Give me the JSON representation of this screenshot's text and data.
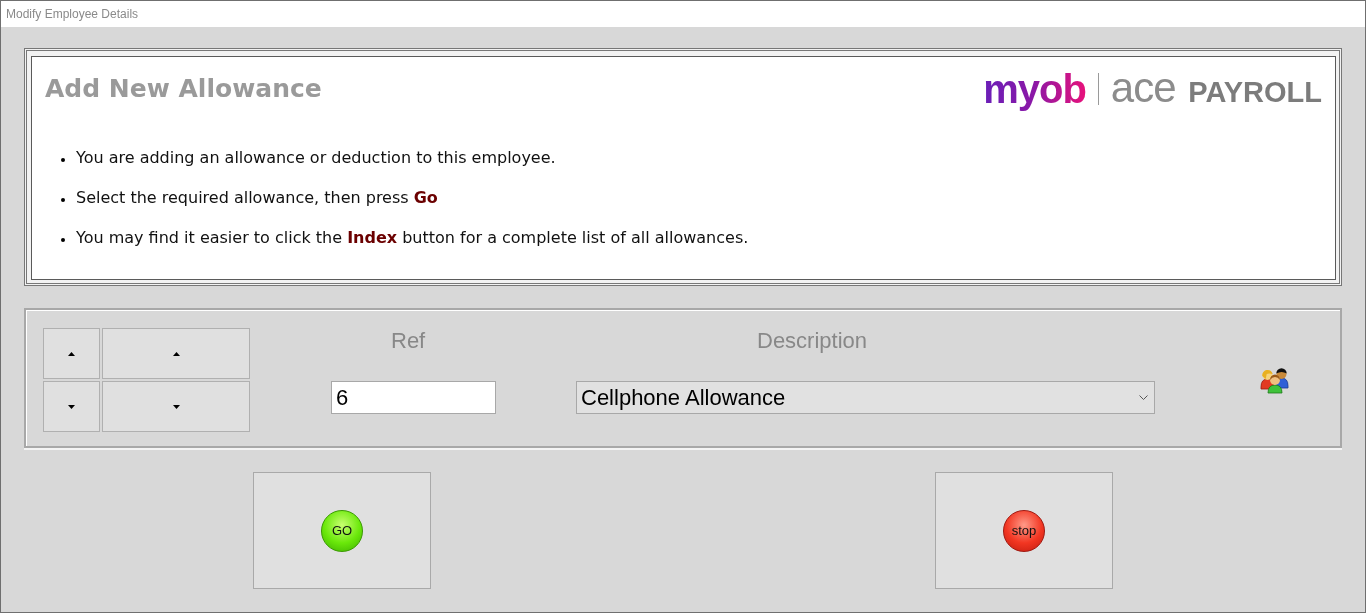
{
  "window": {
    "title": "Modify Employee Details"
  },
  "header": {
    "title": "Add New Allowance",
    "logo": {
      "brand": "myob",
      "product": "ace **PAYROLL**"
    }
  },
  "instructions": [
    "You are adding an allowance or deduction to this employee.",
    "Select the required allowance, then press **Go**",
    "You may find it easier to click the **Index** button for a complete list of all allowances."
  ],
  "form": {
    "ref": {
      "label": "Ref",
      "value": "6"
    },
    "description": {
      "label": "Description",
      "value": "Cellphone Allowance"
    }
  },
  "buttons": [
    {
      "kind": "go",
      "label": "GO"
    },
    {
      "kind": "stop",
      "label": "stop"
    }
  ]
}
